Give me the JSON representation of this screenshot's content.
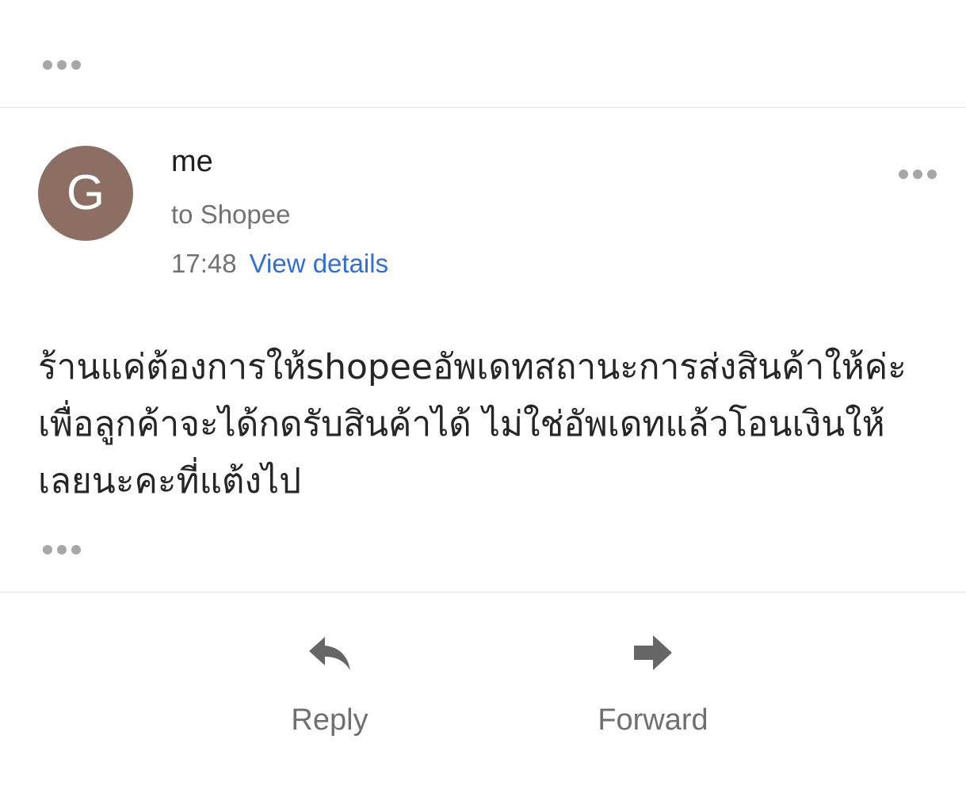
{
  "top_thread": {
    "collapsed_icon": "more-horizontal-dots"
  },
  "message": {
    "avatar_initial": "G",
    "avatar_color": "#8d6e63",
    "sender": "me",
    "recipient": "to Shopee",
    "time": "17:48",
    "details_link": "View details",
    "menu_icon": "more-horizontal-dots",
    "body": "ร้านแค่ต้องการให้shopeeอัพเดทสถานะการส่งสินค้าให้ค่ะ เพื่อลูกค้าจะได้กดรับสินค้าได้ ไม่ใช่อัพเดทแล้วโอนเงินให้เลยนะคะที่แต้งไป",
    "quoted_text_icon": "more-horizontal-dots"
  },
  "actions": {
    "reply_label": "Reply",
    "reply_icon": "reply-arrow",
    "forward_label": "Forward",
    "forward_icon": "forward-arrow"
  },
  "colors": {
    "link": "#2f6fd6",
    "secondary_text": "#727272",
    "icon_gray": "#666666"
  }
}
